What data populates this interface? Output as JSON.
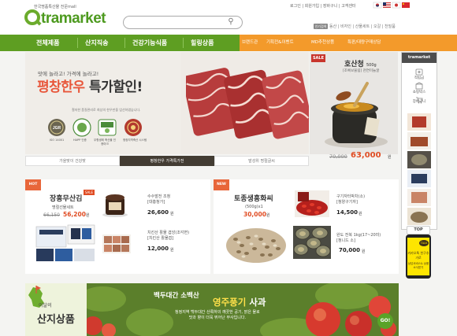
{
  "header": {
    "tagline": "한국명품특산물 전문mall",
    "logo": "tramarket",
    "search_placeholder": "",
    "top_links": "로그인 | 회원가입 | 장바구니 | 고객센터",
    "help_label": "인기검색어",
    "util_links": "동산 | 비자인 | 산물세트 | 오갈 | 천밀품"
  },
  "nav": {
    "main": [
      "전체제품",
      "산지직송",
      "건강기능식품",
      "힐링상품"
    ],
    "sub": [
      "브랜드관",
      "기획전&이벤트",
      "MD추천상품",
      "특판/대량구매상담"
    ]
  },
  "hero": {
    "subtitle": "맛에 놀라고! 가격에 놀라고!",
    "title_colored": "평창한우",
    "title_rest": " 특가할인!",
    "description": "철저한 품질관리로 최상의 한우만을 엄선하였습니다.",
    "certs": [
      "ISO 14001",
      "HAPP 인증",
      "무항생제 축산물 인증마크",
      "청정지역축산 시스템"
    ],
    "tabs": [
      "가을맞이 건강맞",
      "평창한우 가격특가전",
      "발성위 명절글씨"
    ]
  },
  "featured": {
    "badge": "SALE",
    "name": "호산청",
    "weight": "500g",
    "desc": "[조록보물림] 천연미늘꿀",
    "orig_price": "70,000",
    "price": "63,000",
    "unit": "원"
  },
  "left_box": {
    "corner": "HOT",
    "name": "장흥무산김",
    "sub": "명절선물세트",
    "orig": "66,150",
    "price": "56,200",
    "unit": "원",
    "items": [
      {
        "name1": "수수발전 조청",
        "name2": "[대흥청가]",
        "price": "26,600"
      },
      {
        "name1": "치킨산 활물 겹앙(조각면)",
        "name2": "[치킨산 활물겹]",
        "price": "12,000"
      }
    ]
  },
  "right_box": {
    "corner": "NEW",
    "name": "토종생흥화씨",
    "sub": "(500g)x1",
    "price": "30,000",
    "unit": "원",
    "items": [
      {
        "name1": "구기자터박차(소)",
        "name2": "[청양구기자]",
        "price": "14,500"
      },
      {
        "name1": "완도 전복 1kg(17~20미)",
        "name2": "[청니드 소]",
        "price": "70,000"
      }
    ]
  },
  "banner": {
    "small": "이달의",
    "big": "산지상품",
    "subtitle": "백두대간 소백산",
    "title_main": "영주풍기",
    "title_tail": " 사과",
    "desc1": "청정지역 백두대간 산록하의 깨끗한 공기, 맑은 물로",
    "desc2": "맛과 향이 더욱 뛰어난 부사입니다.",
    "go": "GO!"
  },
  "sidebar": {
    "logo": "tramarket",
    "items": [
      "적립금",
      "쇼핑박스",
      "장바구니"
    ],
    "top": "TOP",
    "kakao_talk": "TALK",
    "kakao_text": "카카오톡 친구추가로",
    "kakao_text2": "상담서비스& 상품소식받기"
  }
}
